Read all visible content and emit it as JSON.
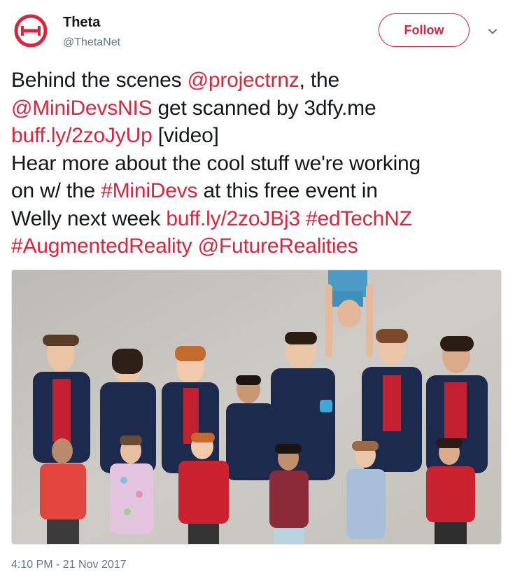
{
  "author": {
    "display_name": "Theta",
    "handle": "@ThetaNet",
    "avatar_icon": "theta-logo-icon",
    "brand_color": "#d7263d"
  },
  "follow_button": {
    "label": "Follow"
  },
  "menu_caret_icon": "chevron-down-icon",
  "tweet": {
    "line1_a": "Behind the scenes ",
    "line1_mention": "@projectrnz",
    "line1_b": ", the",
    "line2_mention": "@MiniDevsNIS",
    "line2_b": " get scanned by 3dfy.me",
    "line3_link": "buff.ly/2zoJyUp",
    "line3_b": " [video]",
    "line4": "Hear more about the cool stuff we're working",
    "line5_a": "on w/ the ",
    "line5_hashtag": "#MiniDevs",
    "line5_b": " at this free event in",
    "line6_a": "Welly next week ",
    "line6_link": "buff.ly/2zoJBj3",
    "line6_sp": " ",
    "line6_hashtag": "#edTechNZ",
    "line7_hashtag": "#AugmentedReality",
    "line7_sp": " ",
    "line7_mention": "@FutureRealities"
  },
  "media": {
    "type": "photo",
    "colors": {
      "wall": "#c9c6c1",
      "uniform_navy": "#1c2a4e",
      "uniform_red": "#c2202f"
    }
  },
  "timestamp": "4:10 PM - 21 Nov 2017"
}
